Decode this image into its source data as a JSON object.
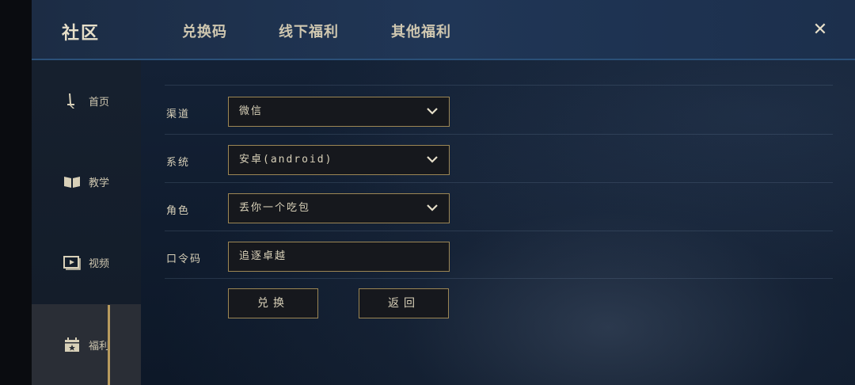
{
  "header": {
    "title": "社区",
    "tabs": [
      {
        "label": "兑换码"
      },
      {
        "label": "线下福利"
      },
      {
        "label": "其他福利"
      }
    ],
    "close_icon": "close-icon",
    "close_glyph": "✕"
  },
  "sidebar": {
    "items": [
      {
        "label": "首页",
        "icon": "sword-icon"
      },
      {
        "label": "教学",
        "icon": "book-icon"
      },
      {
        "label": "视频",
        "icon": "video-icon"
      },
      {
        "label": "福利",
        "icon": "gift-calendar-icon",
        "active": true
      }
    ]
  },
  "form": {
    "channel": {
      "label": "渠道",
      "value": "微信"
    },
    "system": {
      "label": "系统",
      "value": "安卓(android)"
    },
    "role": {
      "label": "角色",
      "value": "丢你一个吃包"
    },
    "code": {
      "label": "口令码",
      "value": "追逐卓越"
    },
    "redeem_label": "兑换",
    "back_label": "返回"
  },
  "colors": {
    "accent_gold": "#9c8654",
    "active_bar": "#b89b5e",
    "header_border": "#2b5078"
  }
}
